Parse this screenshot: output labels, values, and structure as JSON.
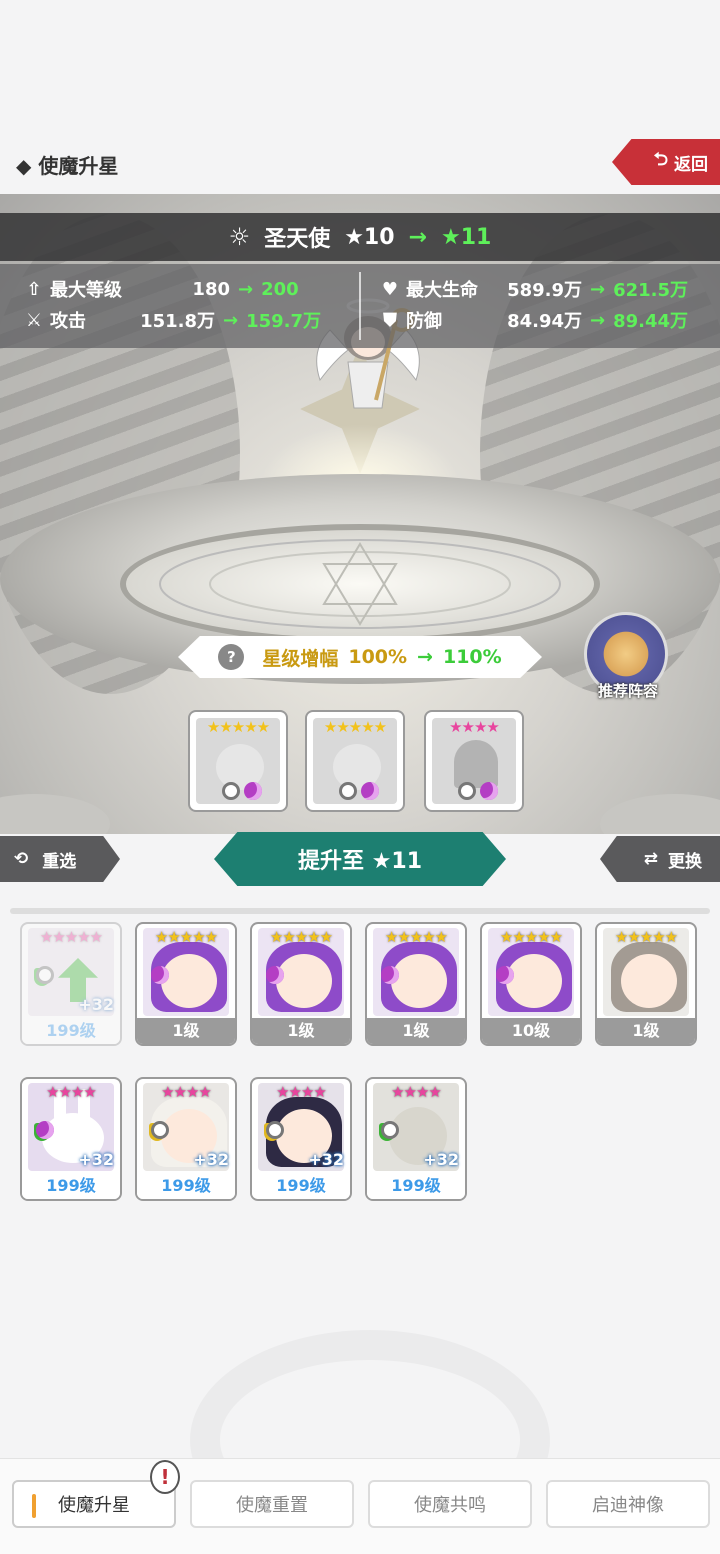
{
  "header": {
    "page_title": "◆ 使魔升星",
    "back_label": "返回"
  },
  "hero": {
    "name": "圣天使",
    "star_from": "★10",
    "star_to": "★11",
    "arrow": "→"
  },
  "stats": {
    "max_level": {
      "label": "最大等级",
      "from": "180",
      "to": "200"
    },
    "attack": {
      "label": "攻击",
      "from": "151.8万",
      "to": "159.7万"
    },
    "max_hp": {
      "label": "最大生命",
      "from": "589.9万",
      "to": "621.5万"
    },
    "defense": {
      "label": "防御",
      "from": "84.94万",
      "to": "89.44万"
    }
  },
  "star_amp": {
    "question": "?",
    "label": "星级增幅",
    "from": "100%",
    "to": "110%"
  },
  "recommend": {
    "label": "推荐阵容"
  },
  "material_slots": [
    {
      "stars": "★★★★★",
      "star_color": "#f2c21b"
    },
    {
      "stars": "★★★★★",
      "star_color": "#f2c21b"
    },
    {
      "stars": "★★★★",
      "star_color": "#e8459e"
    }
  ],
  "actions": {
    "reselect_label": "重选",
    "promote_label": "提升至 ★11",
    "swap_label": "更换"
  },
  "cards_row1": [
    {
      "stars": "★★★★★",
      "star_color": "#e8459e",
      "level": "199级",
      "plus": "+32",
      "state": "disabled"
    },
    {
      "stars": "★★★★★",
      "star_color": "#f2c21b",
      "level": "1级"
    },
    {
      "stars": "★★★★★",
      "star_color": "#f2c21b",
      "level": "1级"
    },
    {
      "stars": "★★★★★",
      "star_color": "#f2c21b",
      "level": "1级"
    },
    {
      "stars": "★★★★★",
      "star_color": "#f2c21b",
      "level": "10级"
    },
    {
      "stars": "★★★★★",
      "star_color": "#f2c21b",
      "level": "1级"
    }
  ],
  "cards_row2": [
    {
      "stars": "★★★★",
      "star_color": "#e8459e",
      "level": "199级",
      "plus": "+32"
    },
    {
      "stars": "★★★★",
      "star_color": "#e8459e",
      "level": "199级",
      "plus": "+32"
    },
    {
      "stars": "★★★★",
      "star_color": "#e8459e",
      "level": "199级",
      "plus": "+32"
    },
    {
      "stars": "★★★★",
      "star_color": "#e8459e",
      "level": "199级",
      "plus": "+32"
    }
  ],
  "tabs": [
    {
      "label": "使魔升星",
      "active": true
    },
    {
      "label": "使魔重置"
    },
    {
      "label": "使魔共鸣"
    },
    {
      "label": "启迪神像"
    }
  ],
  "tab_alert": "!",
  "colors": {
    "accent_teal": "#1d7f71",
    "back_red": "#c83038",
    "stat_green": "#5ef05a",
    "gold": "#c99a12"
  }
}
